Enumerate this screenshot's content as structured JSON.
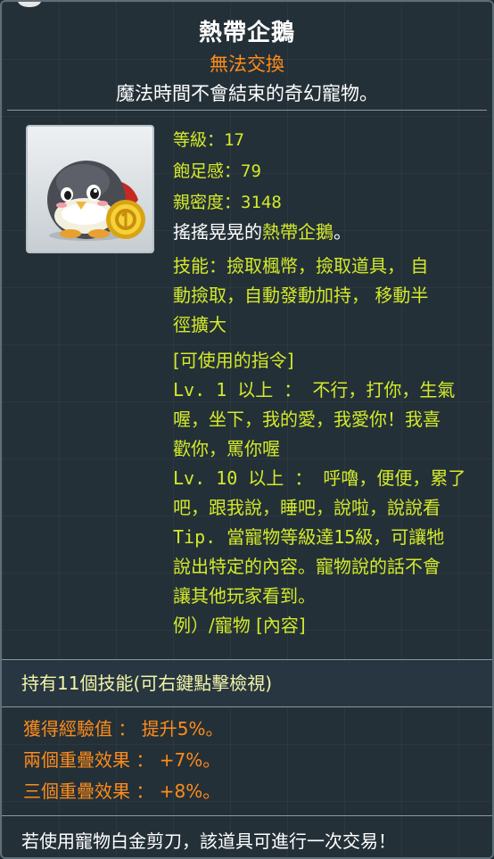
{
  "header": {
    "title": "熱帶企鵝",
    "trade": "無法交換",
    "description": "魔法時間不會結束的奇幻寵物。"
  },
  "pet": {
    "icon": "penguin-pet-icon",
    "accent_color": "#d3ea2a",
    "orange_color": "#ff8c1a"
  },
  "stats": {
    "level_label": "等級：",
    "level_value": "17",
    "fullness_label": "飽足感：",
    "fullness_value": "79",
    "closeness_label": "親密度：",
    "closeness_value": "3148"
  },
  "flavor": {
    "prefix": "搖搖晃晃的",
    "name": "熱帶企鵝",
    "suffix": "。"
  },
  "skills": {
    "line1": "技能：撿取楓幣，撿取道具， 自",
    "line2": "動撿取，自動發動加持， 移動半",
    "line3": "徑擴大"
  },
  "commands": {
    "header": "[可使用的指令]",
    "lines": [
      "Lv. 1 以上 ： 不行，打你，生氣",
      "喔，坐下，我的愛，我愛你！我喜",
      "歡你，罵你喔",
      "Lv. 10 以上 ： 呼嚕，便便，累了",
      "吧，跟我說，睡吧，說啦，說說看",
      "Tip. 當寵物等級達15級，可讓牠",
      "說出特定的內容。寵物說的話不會",
      "讓其他玩家看到。",
      "例）/寵物 [內容]"
    ]
  },
  "skill_count": {
    "text": "持有11個技能(可右鍵點擊檢視)"
  },
  "effects": {
    "exp": "獲得經驗值 ： 提升5%。",
    "double": "兩個重疊效果 ： +7%。",
    "triple": "三個重疊效果 ： +8%。"
  },
  "footer": {
    "text": "若使用寵物白金剪刀，該道具可進行一次交易！"
  }
}
